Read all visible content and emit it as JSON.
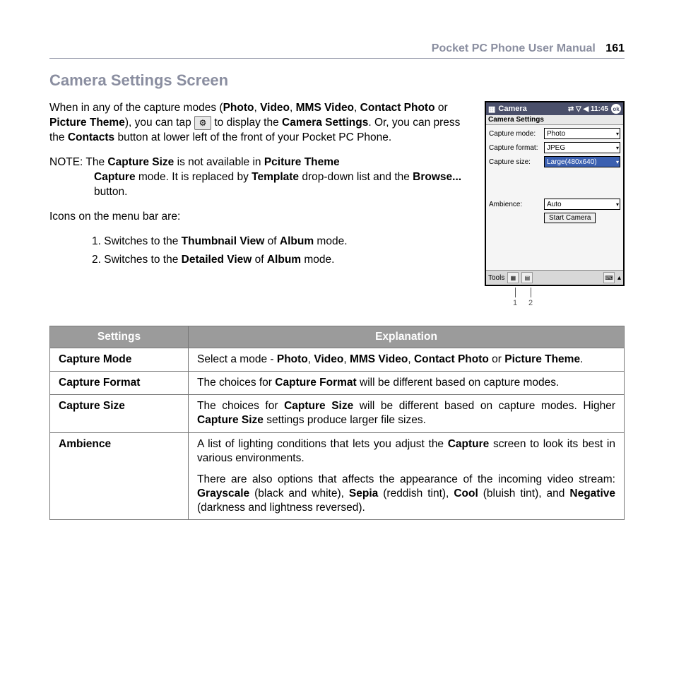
{
  "header": {
    "title": "Pocket PC Phone User Manual",
    "page": "161"
  },
  "section_title": "Camera Settings Screen",
  "para1": {
    "pre": "When in any of the capture modes (",
    "b1": "Photo",
    "b2": "Video",
    "b3": "MMS Video",
    "b4": "Contact Photo",
    "b5": "Picture Theme",
    "mid": "), you can tap ",
    "after_icon": " to display the ",
    "b6": "Camera Settings",
    "mid2": ".   Or, you can press the ",
    "b7": "Contacts",
    "tail": " button at lower left of the front of your Pocket PC Phone."
  },
  "note": {
    "label": "NOTE:",
    "l1a": " The ",
    "b1": "Capture Size",
    "l1b": " is not available in ",
    "b2": "Pciture Theme",
    "l2a": "Capture",
    "l2b": " mode.  It is replaced by ",
    "b3": "Template",
    "l2c": " drop-down list and the ",
    "b4": "Browse...",
    "l2d": " button."
  },
  "icons_intro": "Icons on the menu bar are:",
  "list": {
    "i1a": "1. Switches to the ",
    "i1b": "Thumbnail View",
    "i1c": " of ",
    "i1d": "Album",
    "i1e": " mode.",
    "i2a": "2. Switches to the ",
    "i2b": "Detailed View",
    "i2c": " of ",
    "i2d": "Album",
    "i2e": " mode."
  },
  "device": {
    "title": "Camera",
    "time": "11:45",
    "ok": "ok",
    "subtitle": "Camera Settings",
    "rows": {
      "r1": {
        "label": "Capture mode:",
        "value": "Photo"
      },
      "r2": {
        "label": "Capture format:",
        "value": "JPEG"
      },
      "r3": {
        "label": "Capture size:",
        "value": "Large(480x640)"
      },
      "r4": {
        "label": "Ambience:",
        "value": "Auto"
      }
    },
    "start": "Start Camera",
    "tools": "Tools"
  },
  "callouts": {
    "c1": "1",
    "c2": "2"
  },
  "table": {
    "h1": "Settings",
    "h2": "Explanation",
    "r1": {
      "name": "Capture Mode",
      "pre": "Select a mode - ",
      "b1": "Photo",
      "b2": "Video",
      "b3": "MMS Video",
      "b4": "Contact Photo",
      "or": " or ",
      "b5": "Picture Theme",
      "dot": "."
    },
    "r2": {
      "name": "Capture Format",
      "pre": "The choices for ",
      "b1": "Capture Format",
      "post": " will be different based on capture modes."
    },
    "r3": {
      "name": "Capture Size",
      "pre": "The choices for ",
      "b1": "Capture Size",
      "mid": " will be different based on capture modes. Higher ",
      "b2": "Capture Size",
      "post": " settings produce larger file sizes."
    },
    "r4": {
      "name": "Ambience",
      "p1a": "A list of lighting conditions that lets you adjust the ",
      "p1b": "Capture",
      "p1c": " screen to look its best in various environments.",
      "p2a": "There are also options that affects the appearance of the incoming video stream: ",
      "p2b": "Grayscale",
      "p2c": " (black and white), ",
      "p2d": "Sepia",
      "p2e": " (reddish tint), ",
      "p2f": "Cool",
      "p2g": " (bluish tint), and ",
      "p2h": "Negative",
      "p2i": " (darkness and lightness reversed)."
    }
  }
}
